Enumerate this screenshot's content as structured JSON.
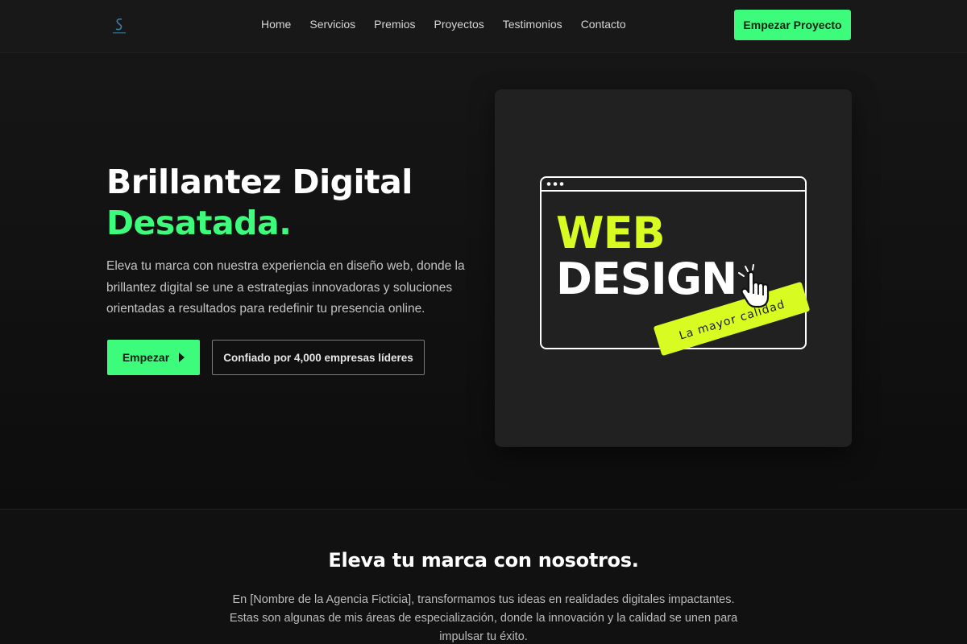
{
  "nav": {
    "logo_icon": "s-logo-icon",
    "links": [
      "Home",
      "Servicios",
      "Premios",
      "Proyectos",
      "Testimonios",
      "Contacto"
    ],
    "cta_label": "Empezar Proyecto"
  },
  "hero": {
    "title_line1": "Brillantez Digital",
    "title_line2": "Desatada.",
    "description": "Eleva tu marca con nuestra experiencia en diseño web, donde la brillantez digital se une a estrategias innovadoras y soluciones orientadas a resultados para redefinir tu presencia online.",
    "primary_button": "Empezar",
    "primary_button_icon": "caret-right-icon",
    "secondary_button": "Confiado por 4,000 empresas líderes"
  },
  "illustration": {
    "word1": "WEB",
    "word2": "DESIGN",
    "tag": "La mayor calidad",
    "pointer_icon": "hand-pointer-icon"
  },
  "section": {
    "title": "Eleva tu marca con nosotros.",
    "description": "En [Nombre de la Agencia Ficticia], transformamos tus ideas en realidades digitales impactantes. Estas son algunas de mis áreas de especialización, donde la innovación y la calidad se unen para impulsar tu éxito."
  },
  "colors": {
    "accent": "#3dfc7b",
    "lime": "#d8fb22",
    "background": "#111111",
    "card": "#212121"
  }
}
